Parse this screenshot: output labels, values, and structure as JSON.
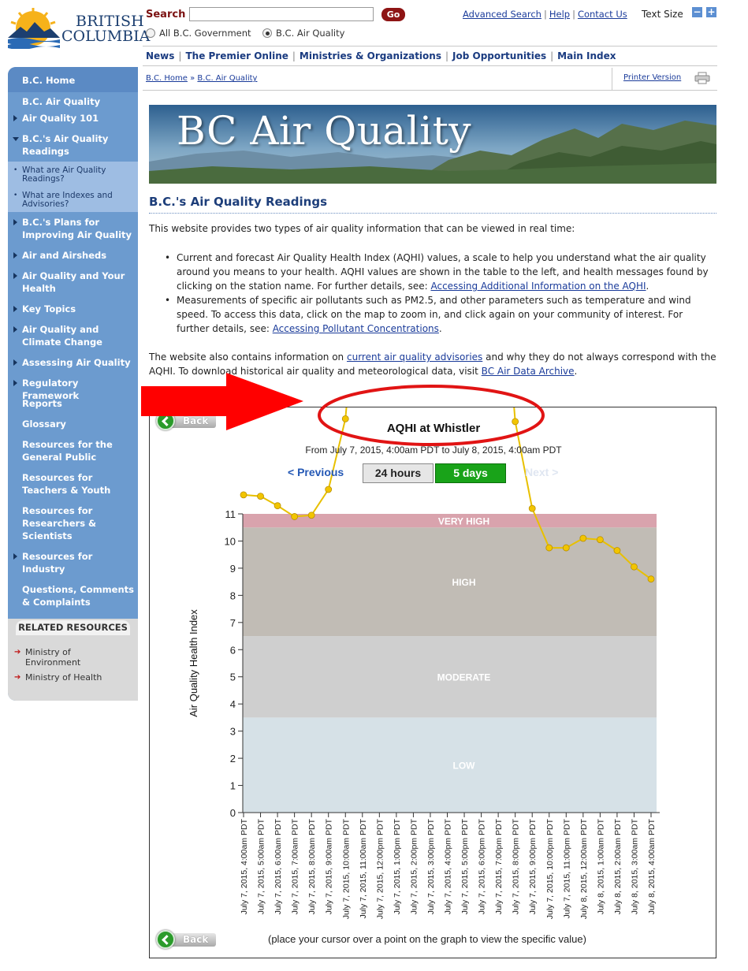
{
  "logo": {
    "line1": "BRITISH",
    "line2": "COLUMBIA",
    "icon": "bc-sun-mountains-logo"
  },
  "search": {
    "label": "Search",
    "value": "",
    "go": "Go",
    "scopes": [
      {
        "label": "All B.C. Government",
        "checked": false
      },
      {
        "label": "B.C. Air Quality",
        "checked": true
      }
    ]
  },
  "util": {
    "advanced": "Advanced Search",
    "help": "Help",
    "contact": "Contact Us",
    "sep": "|",
    "text_size": "Text Size",
    "minus": "−",
    "plus": "+"
  },
  "topnav": [
    "News",
    "The Premier Online",
    "Ministries & Organizations",
    "Job Opportunities",
    "Main Index"
  ],
  "breadcrumb": {
    "home": "B.C. Home",
    "sep": "»",
    "current": "B.C. Air Quality"
  },
  "printer": {
    "label": "Printer Version",
    "icon": "printer-icon"
  },
  "sidebar": {
    "home": "B.C. Home",
    "items": [
      {
        "label": "B.C. Air Quality",
        "marker": "none"
      },
      {
        "label": "Air Quality 101",
        "marker": "arrow"
      },
      {
        "label": "B.C.'s Air Quality Readings",
        "marker": "down"
      },
      {
        "label": "B.C.'s Plans for Improving Air Quality",
        "marker": "arrow"
      },
      {
        "label": "Air and Airsheds",
        "marker": "arrow"
      },
      {
        "label": "Air Quality and Your Health",
        "marker": "arrow"
      },
      {
        "label": "Key Topics",
        "marker": "arrow"
      },
      {
        "label": "Air Quality and Climate Change",
        "marker": "arrow"
      },
      {
        "label": "Assessing Air Quality",
        "marker": "arrow"
      },
      {
        "label": "Regulatory Framework",
        "marker": "arrow"
      },
      {
        "label": "Reports",
        "marker": "none"
      },
      {
        "label": "Glossary",
        "marker": "none"
      },
      {
        "label": "Resources for the General Public",
        "marker": "none"
      },
      {
        "label": "Resources for Teachers & Youth",
        "marker": "none"
      },
      {
        "label": "Resources for Researchers & Scientists",
        "marker": "none"
      },
      {
        "label": "Resources for Industry",
        "marker": "arrow"
      },
      {
        "label": "Questions, Comments & Complaints",
        "marker": "none"
      }
    ],
    "subitems": [
      "What are Air Quality Readings?",
      "What are Indexes and Advisories?"
    ],
    "related": {
      "title": "RELATED RESOURCES",
      "items": [
        "Ministry of Environment",
        "Ministry of Health"
      ]
    }
  },
  "banner": {
    "title": "BC Air Quality"
  },
  "main": {
    "title": "B.C.'s Air Quality Readings",
    "intro": "This website provides two types of air quality information that can be viewed in real time:",
    "bullet1": "Current and forecast Air Quality Health Index (AQHI) values, a scale to help you understand what the air quality around you means to your health. AQHI values are shown in the table to the left, and health messages found by clicking on the station name. For further details, see: ",
    "bullet1_link": "Accessing Additional Information on the AQHI",
    "bullet2": "Measurements of specific air pollutants such as PM2.5, and other parameters such as temperature and wind speed. To access this data, click on the map to zoom in, and click again on your community of interest. For further details, see: ",
    "bullet2_link": "Accessing Pollutant Concentrations",
    "para2_a": "The website also contains information on ",
    "para2_link1": "current air quality advisories",
    "para2_b": " and why they do not always correspond with the AQHI. To download historical air quality and meteorological data, visit ",
    "para2_link2": "BC Air Data Archive",
    "para2_c": "."
  },
  "chart_panel": {
    "back": "Back",
    "prev": "< Previous",
    "next": "Next >",
    "btn_24": "24 hours",
    "btn_5d": "5 days",
    "hint": "(place your cursor over a point on the graph to view the specific value)"
  },
  "chart_data": {
    "type": "line",
    "title": "AQHI at Whistler",
    "subtitle": "From July 7, 2015, 4:00am PDT to July 8, 2015, 4:00am PDT",
    "ylabel": "Air Quality Health Index",
    "xlabel": "",
    "ylim": [
      0,
      11
    ],
    "yticks": [
      0,
      1,
      2,
      3,
      4,
      5,
      6,
      7,
      8,
      9,
      10,
      11
    ],
    "bands": [
      {
        "label": "LOW",
        "from": 0,
        "to": 3.5,
        "color": "#d6e1e7"
      },
      {
        "label": "MODERATE",
        "from": 3.5,
        "to": 6.5,
        "color": "#cfcfcf"
      },
      {
        "label": "HIGH",
        "from": 6.5,
        "to": 10.5,
        "color": "#c1bcb5"
      },
      {
        "label": "VERY HIGH",
        "from": 10.5,
        "to": 11,
        "color": "#d9a3ad"
      }
    ],
    "line_color": "#e8c000",
    "point_color": "#f2c500",
    "categories": [
      "July 7, 2015, 4:00am PDT",
      "July 7, 2015, 5:00am PDT",
      "July 7, 2015, 6:00am PDT",
      "July 7, 2015, 7:00am PDT",
      "July 7, 2015, 8:00am PDT",
      "July 7, 2015, 9:00am PDT",
      "July 7, 2015, 10:00am PDT",
      "July 7, 2015, 11:00am PDT",
      "July 7, 2015, 12:00pm PDT",
      "July 7, 2015, 1:00pm PDT",
      "July 7, 2015, 2:00pm PDT",
      "July 7, 2015, 3:00pm PDT",
      "July 7, 2015, 4:00pm PDT",
      "July 7, 2015, 5:00pm PDT",
      "July 7, 2015, 6:00pm PDT",
      "July 7, 2015, 7:00pm PDT",
      "July 7, 2015, 8:00pm PDT",
      "July 7, 2015, 9:00pm PDT",
      "July 7, 2015, 10:00pm PDT",
      "July 7, 2015, 11:00pm PDT",
      "July 8, 2015, 12:00am PDT",
      "July 8, 2015, 1:00am PDT",
      "July 8, 2015, 2:00am PDT",
      "July 8, 2015, 3:00am PDT",
      "July 8, 2015, 4:00am PDT"
    ],
    "values": [
      11.7,
      11.65,
      11.3,
      10.9,
      10.95,
      11.9,
      14.5,
      null,
      null,
      null,
      null,
      null,
      null,
      null,
      null,
      null,
      14.4,
      11.2,
      9.75,
      9.75,
      10.1,
      10.05,
      9.65,
      9.05,
      8.6
    ]
  },
  "annotations": {
    "arrow_color": "#ff0000",
    "circle_color": "#e11414"
  }
}
